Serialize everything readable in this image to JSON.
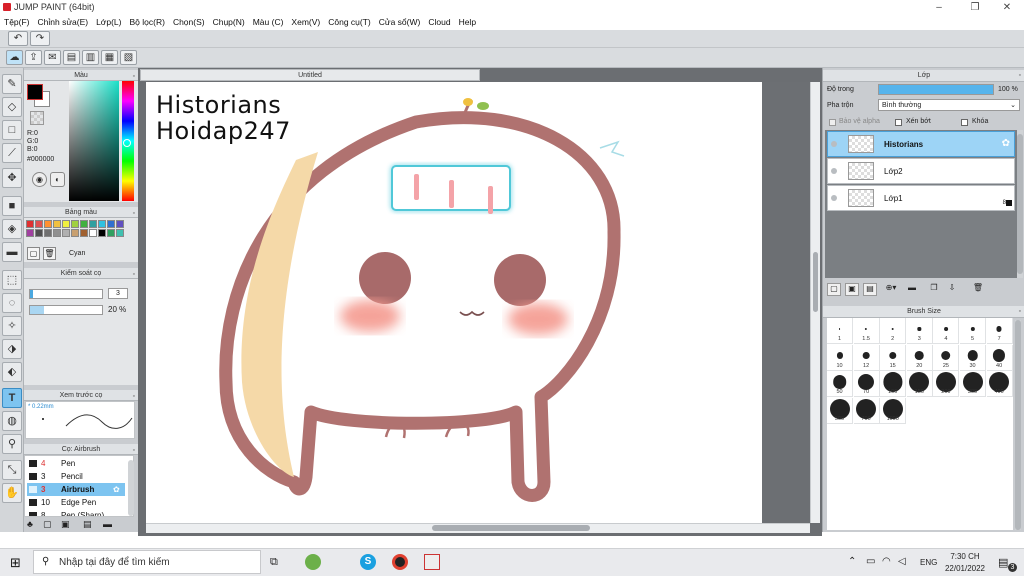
{
  "window": {
    "title": "JUMP PAINT (64bit)",
    "minimize": "–",
    "maximize": "❐",
    "close": "✕"
  },
  "menu": [
    "Tệp(F)",
    "Chỉnh sửa(E)",
    "Lớp(L)",
    "Bộ lọc(R)",
    "Chọn(S)",
    "Chụp(N)",
    "Màu (C)",
    "Xem(V)",
    "Công cụ(T)",
    "Cửa sổ(W)",
    "Cloud",
    "Help"
  ],
  "panels": {
    "color": {
      "title": "Màu",
      "r": "R:0",
      "g": "G:0",
      "b": "B:0",
      "hex": "#000000"
    },
    "swatches": {
      "title": "Bảng màu",
      "selected_name": "Cyan"
    },
    "brush_control": {
      "title": "Kiểm soát cọ",
      "size_value": "3",
      "opacity_value": "20 %"
    },
    "preview": {
      "title": "Xem trước cọ",
      "size_text": "* 0.22mm"
    },
    "brush_list": {
      "title": "Cọ: Airbrush",
      "items": [
        {
          "num": "4",
          "name": "Pen",
          "color": "#222222"
        },
        {
          "num": "3",
          "name": "Pencil",
          "color": "#222222"
        },
        {
          "num": "3",
          "name": "Airbrush",
          "color": "#a0d8f5"
        },
        {
          "num": "10",
          "name": "Edge Pen",
          "color": "#222222"
        },
        {
          "num": "8",
          "name": "Pen (Sharp)",
          "color": "#222222"
        }
      ]
    }
  },
  "document": {
    "tab_title": "Untitled",
    "canvas_text_line1": "Historians",
    "canvas_text_line2": "Hoidap247"
  },
  "layers": {
    "title": "Lớp",
    "opacity_label": "Độ trong",
    "opacity_value": "100 %",
    "blend_label": "Pha trộn",
    "blend_value": "Bình thường",
    "protect_alpha": "Bảo vệ alpha",
    "clipping": "Xén bớt",
    "lock": "Khóa",
    "rows": [
      {
        "name": "Historians",
        "selected": true
      },
      {
        "name": "Lớp2",
        "selected": false
      },
      {
        "name": "Lớp1",
        "selected": false
      }
    ],
    "badge": "8"
  },
  "brush_size": {
    "title": "Brush Size",
    "sizes": [
      "1",
      "1.5",
      "2",
      "3",
      "4",
      "5",
      "7",
      "10",
      "12",
      "15",
      "20",
      "25",
      "30",
      "40",
      "50",
      "70",
      "100",
      "150",
      "200",
      "300",
      "400",
      "500",
      "700",
      "1000"
    ]
  },
  "taskbar": {
    "search_placeholder": "Nhập tại đây để tìm kiếm",
    "language": "ENG",
    "time": "7:30 CH",
    "date": "22/01/2022",
    "notifications": "3"
  },
  "colors": {
    "accent": "#7dc4f0",
    "canvas_outline": "#b07270",
    "blush": "#f49a8f",
    "cheek_fill": "#f5d9a8",
    "glow": "#50c8d8"
  }
}
